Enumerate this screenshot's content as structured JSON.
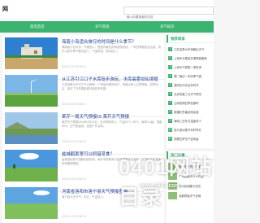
{
  "header": {
    "logo_text": "网",
    "search_placeholder": "输入你要搜索的内容"
  },
  "nav": {
    "items": [
      {
        "label": "首页首页"
      },
      {
        "label": "天气资讯"
      },
      {
        "label": "天气知识"
      }
    ]
  },
  "articles": [
    {
      "title": "海南小岛适合旅行的时间是什么季节？",
      "excerpt": "海南省小岛众多，气候宜人，是国内著名的海滨旅游地，一年四季都适合出游，其中以秋冬季节最为宜人，气温舒适，雨水较少。",
      "date": "2024-04-10 09:36:04"
    },
    {
      "title": "从江苏引江口子水库徒步游玩，水库晨雾如仙境般",
      "excerpt": "江苏省泰州市引江子水库是一个风景优美的地方，清晨水库上云雾缭绕，如梦如幻，吸引了许多摄影爱好者前来拍摄。",
      "date": "2024-04-10 09:36:04"
    },
    {
      "title": "莱芹一周天气预报15 莱芹天气预报",
      "excerpt": "莱芹天气预报2024年4月10日：全天晴转多云，气温20℃~28℃，南风3-4级，湿度60%，空气质量良，适宜户外活动。",
      "date": "2024-04-10 09:36:04"
    },
    {
      "title": "盐城鹤那里可以抓猎觅食？",
      "excerpt": "盐城湿地是丹顶鹤的越冬地，每年冬季都有大量丹顶鹤来此越冬，在湿地中觅食鱼虾和植物根茎。",
      "date": "2024-04-10 09:36:04"
    },
    {
      "title": "河南省洛阳市洛宁县天气预报查询",
      "excerpt": "洛宁县今天天气：多云，气温宜人。",
      "date": "2024-04-10 09:36:04"
    }
  ],
  "sidebar": {
    "recommend_title": "推荐阅读",
    "recommend_items": [
      {
        "num": "1",
        "text": "江苏省泰州市海陵区天气"
      },
      {
        "num": "2",
        "text": "上海冬天雪景在哪里看最美"
      },
      {
        "num": "3",
        "text": "上海天气预报一周查询"
      },
      {
        "num": "4",
        "text": "厦门海边一年四季气候"
      },
      {
        "num": "5",
        "text": "洛阳牡丹花会何时开"
      },
      {
        "num": "6",
        "text": "北京阳春三月天气情况"
      },
      {
        "num": "7",
        "text": "云南昆明四季如春吗"
      },
      {
        "num": "8",
        "text": "新疆吐鲁番盆地高温"
      },
      {
        "num": "9",
        "text": "海南三亚冬天温度多少"
      },
      {
        "num": "10",
        "text": "哈尔滨冰雪节何时举办"
      },
      {
        "num": "11",
        "text": "西藏拉萨空气含氧量"
      }
    ],
    "hot_title": "热门文章",
    "hot_items": [
      {
        "text": "洛阳天气预报一周"
      },
      {
        "text": "广州回南天什么时候"
      },
      {
        "text": "杭州西湖春天赏花"
      },
      {
        "text": "成都雾霾天气说明"
      }
    ]
  },
  "watermark": {
    "text": "0401网站目录",
    "sub": "www.0401.com"
  },
  "colors": {
    "accent": "#3cb371",
    "title_link": "#1a3c8f"
  }
}
